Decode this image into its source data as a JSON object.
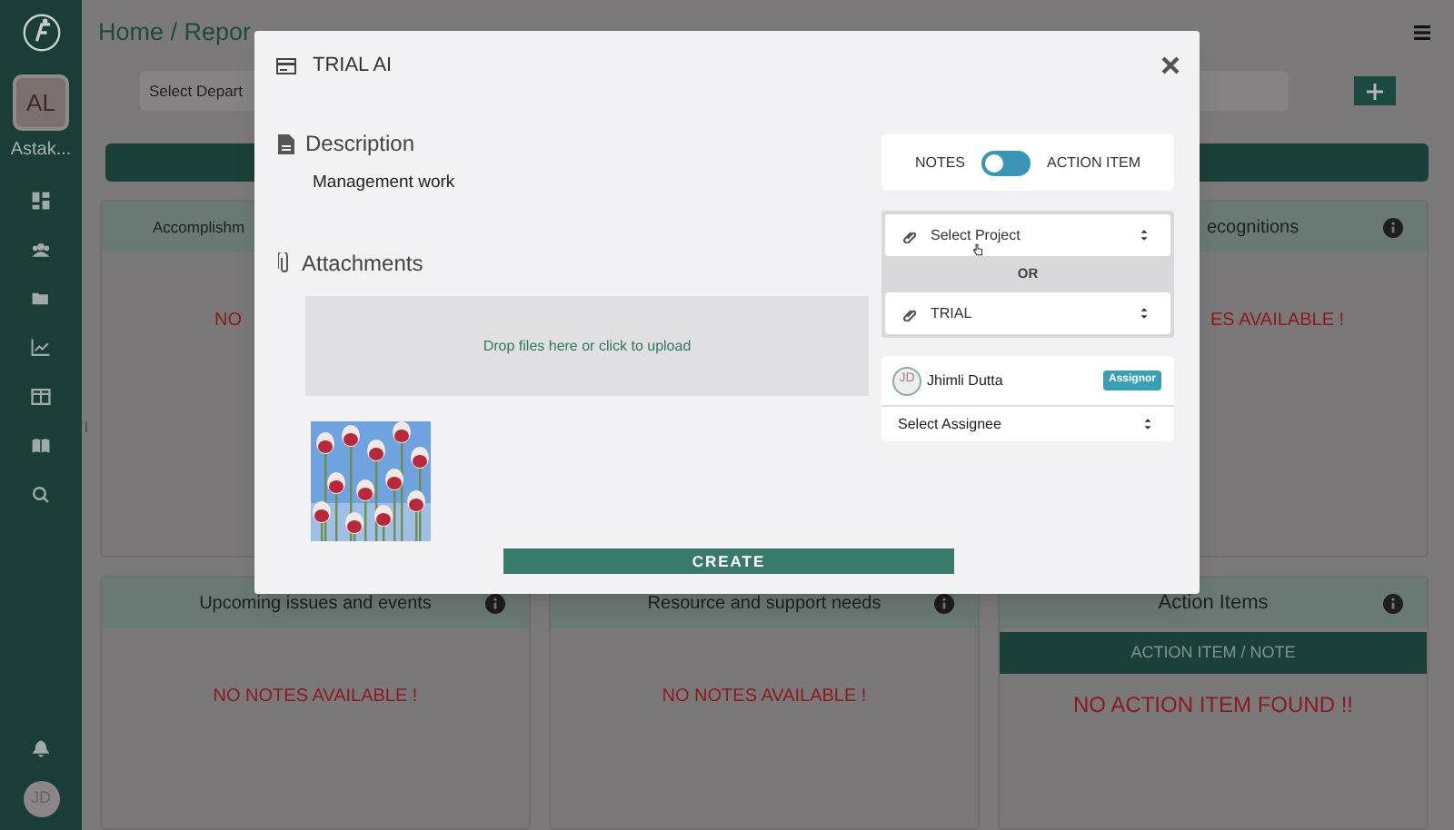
{
  "sidebar": {
    "avatar": "AL",
    "user": "Astak...",
    "footer_avatar": "JD"
  },
  "header": {
    "breadcrumb": "Home / Repor"
  },
  "toolbar": {
    "department_select": "Select Depart"
  },
  "cards": [
    {
      "title": "Accomplishm",
      "message": "NO"
    },
    {
      "title": "ecognitions",
      "message": "ES AVAILABLE !",
      "info": true
    },
    {
      "title": "Upcoming issues and events",
      "message": "NO NOTES AVAILABLE !",
      "info": true
    },
    {
      "title": "Resource and support needs",
      "message": "NO NOTES AVAILABLE !",
      "info": true
    },
    {
      "title": "Action Items",
      "bar": "ACTION ITEM / NOTE",
      "message": "NO ACTION ITEM FOUND !!",
      "info": true
    }
  ],
  "modal": {
    "title": "TRIAL AI",
    "description_label": "Description",
    "description": "Management work",
    "attachments_label": "Attachments",
    "dropzone": "Drop files here or click to upload",
    "toggle": {
      "left": "NOTES",
      "right": "ACTION ITEM",
      "on": false
    },
    "project_select": "Select Project",
    "or": "OR",
    "second_select": "TRIAL",
    "assignor": {
      "initials": "JD",
      "name": "Jhimli Dutta",
      "badge": "Assignor"
    },
    "assignee_select": "Select Assignee",
    "create": "CREATE"
  }
}
